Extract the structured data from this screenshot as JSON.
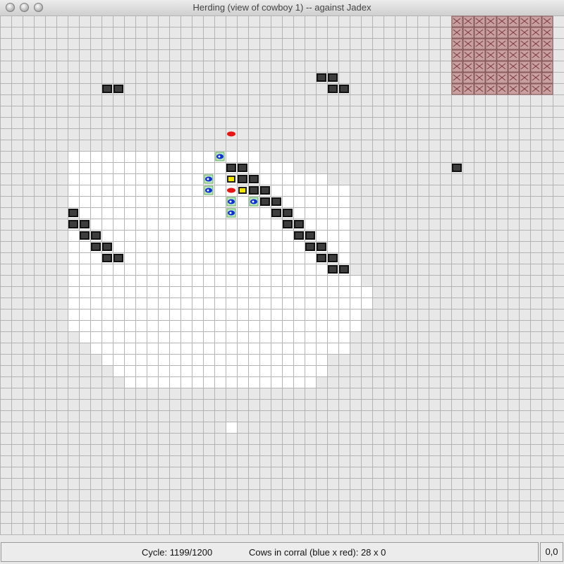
{
  "window": {
    "title": "Herding (view of cowboy 1) -- against Jadex",
    "buttons": [
      "close",
      "minimize",
      "zoom"
    ]
  },
  "status": {
    "cycle_label": "Cycle: 1199/1200",
    "corral_label": "Cows in corral (blue x red): 28 x 0",
    "coords": "0,0"
  },
  "colors": {
    "background": "#e8e8e8",
    "grid_line": "#b4b4b4",
    "visible_cell": "#ffffff",
    "obstacle": "#3d3d3d",
    "corral": "#c9a0a0",
    "blue_cowboy": "#0a2fd6",
    "red_cowboy": "#e81414",
    "cow": "#f2e600"
  },
  "icons": {
    "obstacle": "obstacle-block-icon",
    "corral": "corral-fence-icon",
    "blue_cowboy": "blue-cowboy-icon",
    "red_cowboy": "red-cowboy-icon",
    "cow": "cow-icon"
  }
}
